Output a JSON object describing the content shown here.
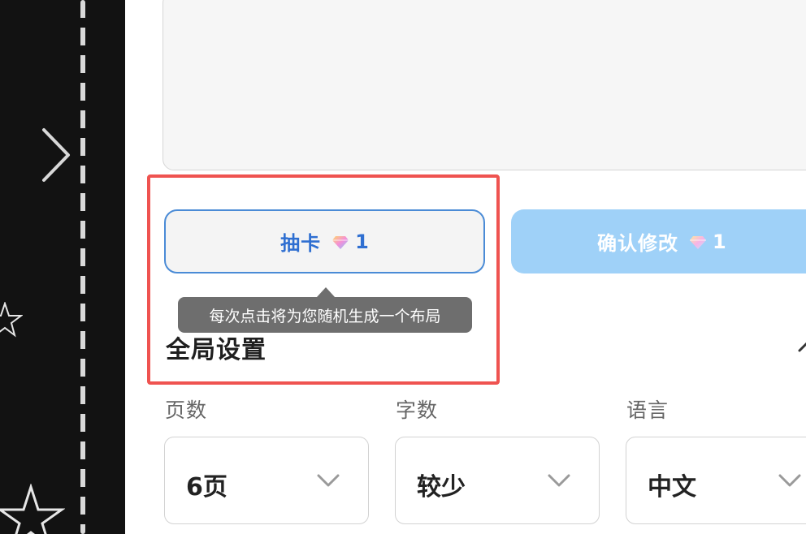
{
  "actions": {
    "draw_card": {
      "label": "抽卡",
      "cost": "1"
    },
    "confirm": {
      "label": "确认修改",
      "cost": "1"
    }
  },
  "tooltip": {
    "text": "每次点击将为您随机生成一个布局"
  },
  "global_settings": {
    "title": "全局设置",
    "fields": [
      {
        "label": "页数",
        "value": "6页"
      },
      {
        "label": "字数",
        "value": "较少"
      },
      {
        "label": "语言",
        "value": "中文"
      }
    ]
  },
  "icons": {
    "draw_cost": "diamond-gem-icon",
    "confirm_cost": "diamond-gem-icon",
    "left_nav": "chevron-right-icon",
    "collapse": "chevron-up-icon",
    "select": "chevron-down-icon"
  },
  "colors": {
    "accent": "#2f6fd1",
    "confirm_bg": "#9fd1f8",
    "highlight": "#ef5350",
    "tooltip_bg": "#6e6e6e"
  }
}
